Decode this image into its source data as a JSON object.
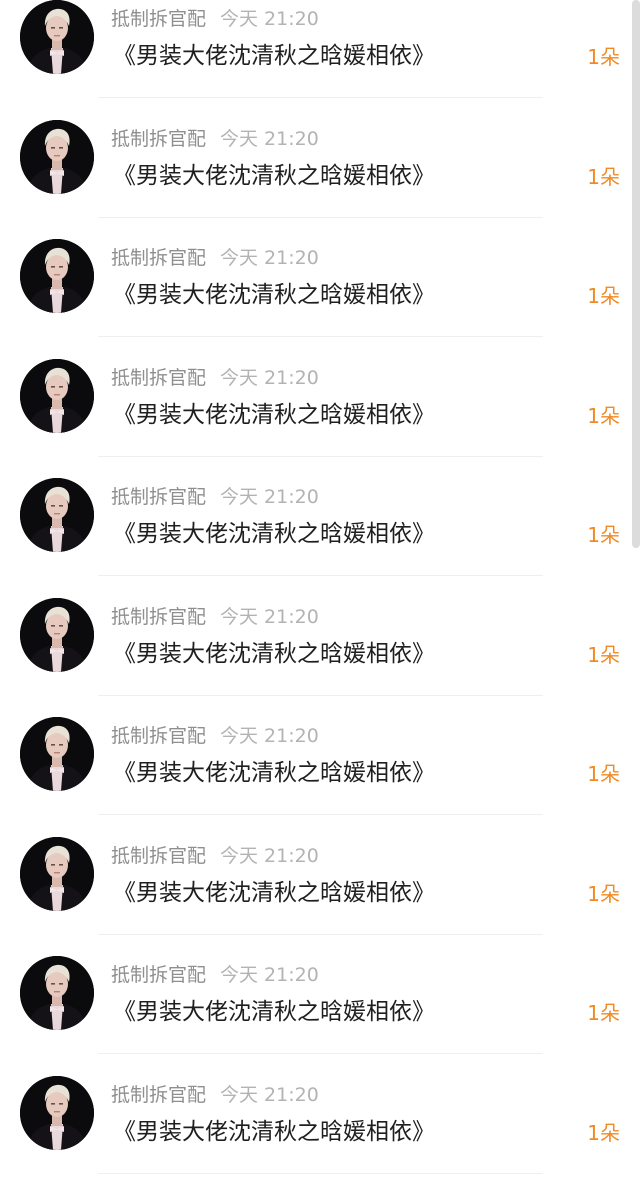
{
  "items": [
    {
      "sender": "抵制拆官配",
      "time": "今天 21:20",
      "gift": "《男装大佬沈清秋之晗媛相依》",
      "count": "1朵"
    },
    {
      "sender": "抵制拆官配",
      "time": "今天 21:20",
      "gift": "《男装大佬沈清秋之晗媛相依》",
      "count": "1朵"
    },
    {
      "sender": "抵制拆官配",
      "time": "今天 21:20",
      "gift": "《男装大佬沈清秋之晗媛相依》",
      "count": "1朵"
    },
    {
      "sender": "抵制拆官配",
      "time": "今天 21:20",
      "gift": "《男装大佬沈清秋之晗媛相依》",
      "count": "1朵"
    },
    {
      "sender": "抵制拆官配",
      "time": "今天 21:20",
      "gift": "《男装大佬沈清秋之晗媛相依》",
      "count": "1朵"
    },
    {
      "sender": "抵制拆官配",
      "time": "今天 21:20",
      "gift": "《男装大佬沈清秋之晗媛相依》",
      "count": "1朵"
    },
    {
      "sender": "抵制拆官配",
      "time": "今天 21:20",
      "gift": "《男装大佬沈清秋之晗媛相依》",
      "count": "1朵"
    },
    {
      "sender": "抵制拆官配",
      "time": "今天 21:20",
      "gift": "《男装大佬沈清秋之晗媛相依》",
      "count": "1朵"
    },
    {
      "sender": "抵制拆官配",
      "time": "今天 21:20",
      "gift": "《男装大佬沈清秋之晗媛相依》",
      "count": "1朵"
    },
    {
      "sender": "抵制拆官配",
      "time": "今天 21:20",
      "gift": "《男装大佬沈清秋之晗媛相依》",
      "count": "1朵"
    }
  ],
  "colors": {
    "count": "#f08a24",
    "sender": "#8f8f8f",
    "time": "#b3b3b3",
    "gift": "#1f1f1f"
  }
}
